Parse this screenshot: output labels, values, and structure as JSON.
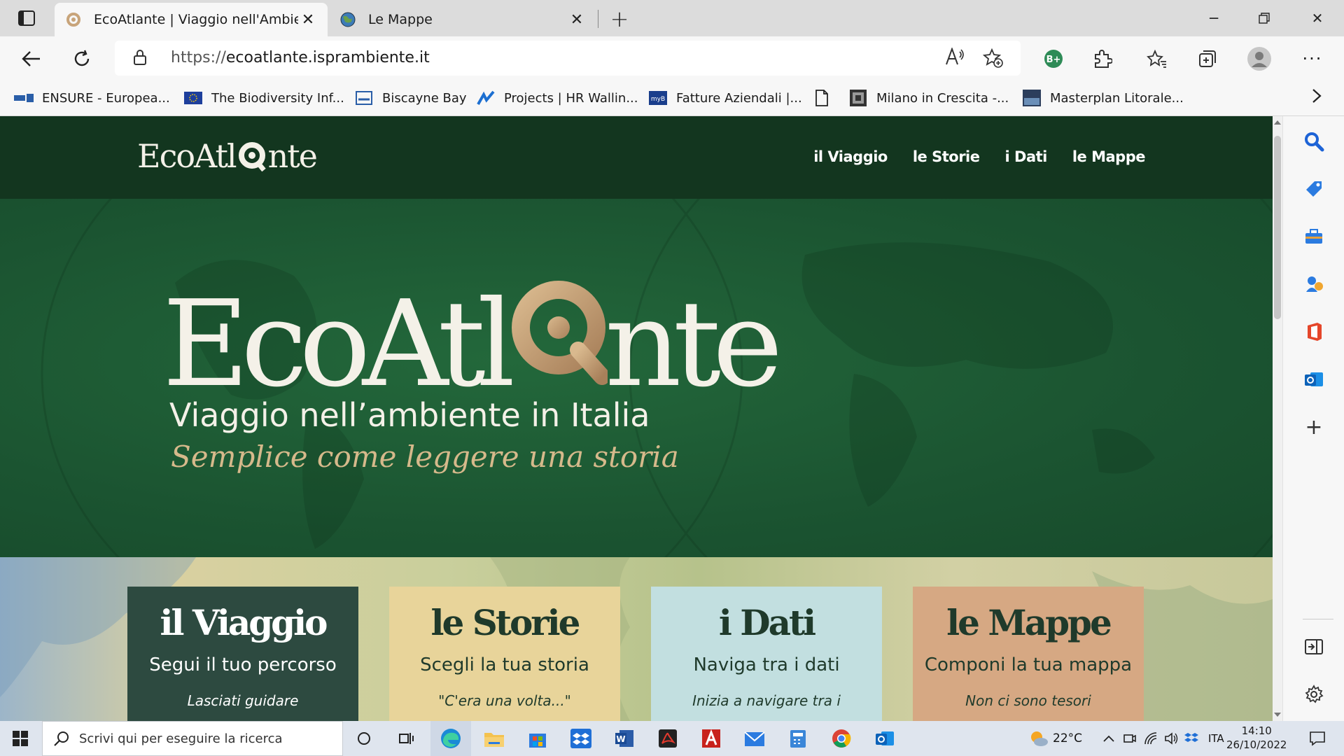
{
  "browser": {
    "tabs": [
      {
        "title": "EcoAtlante | Viaggio nell'Ambien",
        "active": true
      },
      {
        "title": "Le Mappe",
        "active": false
      }
    ],
    "url_protocol": "https://",
    "url_host": "ecoatlante.isprambiente.it",
    "read_aloud_label": "Aͅ",
    "favorites": [
      {
        "label": "ENSURE - Europea...",
        "icon": "ensure-icon"
      },
      {
        "label": "The Biodiversity Inf...",
        "icon": "eu-flag-icon"
      },
      {
        "label": "Biscayne Bay",
        "icon": "biscayne-icon"
      },
      {
        "label": "Projects | HR Wallin...",
        "icon": "hr-wallingford-icon"
      },
      {
        "label": "Fatture Aziendali |...",
        "icon": "myb-icon"
      },
      {
        "label": "",
        "icon": "page-icon"
      },
      {
        "label": "Milano in Crescita -...",
        "icon": "milano-icon"
      },
      {
        "label": "Masterplan Litorale...",
        "icon": "masterplan-icon"
      }
    ],
    "profile_badge": "B+"
  },
  "site": {
    "logo_text": "EcoAtl",
    "logo_tail": "nte",
    "nav": [
      "il Viaggio",
      "le Storie",
      "i Dati",
      "le Mappe"
    ],
    "hero": {
      "logo_text": "EcoAtl",
      "logo_tail": "nte",
      "subtitle": "Viaggio nell’ambiente in Italia",
      "tagline": "Semplice come leggere una storia"
    },
    "cards": [
      {
        "title": "il Viaggio",
        "subtitle": "Segui il tuo percorso",
        "text": "Lasciati guidare"
      },
      {
        "title": "le Storie",
        "subtitle": "Scegli la tua storia",
        "text": "\"C'era una volta...\""
      },
      {
        "title": "i Dati",
        "subtitle": "Naviga tra i dati",
        "text": "Inizia a navigare tra i"
      },
      {
        "title": "le Mappe",
        "subtitle": "Componi la tua mappa",
        "text": "Non ci sono tesori"
      }
    ]
  },
  "taskbar": {
    "search_placeholder": "Scrivi qui per eseguire la ricerca",
    "temperature": "22°C",
    "language": "ITA",
    "time": "14:10",
    "date": "26/10/2022"
  },
  "colors": {
    "site_header": "#13361f",
    "hero_green": "#1f5a35",
    "gold_accent": "#c8a47a"
  }
}
